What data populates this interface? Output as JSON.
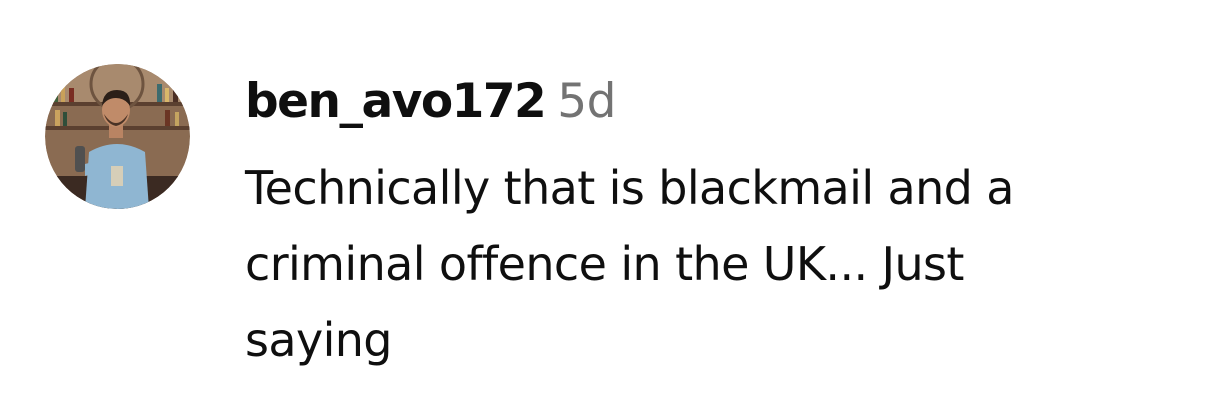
{
  "comment": {
    "username": "ben_avo172",
    "timestamp": "5d",
    "text": "Technically that is blackmail and a\ncriminal offence in the UK... Just\nsaying"
  },
  "colors": {
    "text": "#0f0f0f",
    "timestamp": "#737373",
    "background": "#ffffff"
  },
  "icons": {
    "avatar": "profile-photo"
  }
}
